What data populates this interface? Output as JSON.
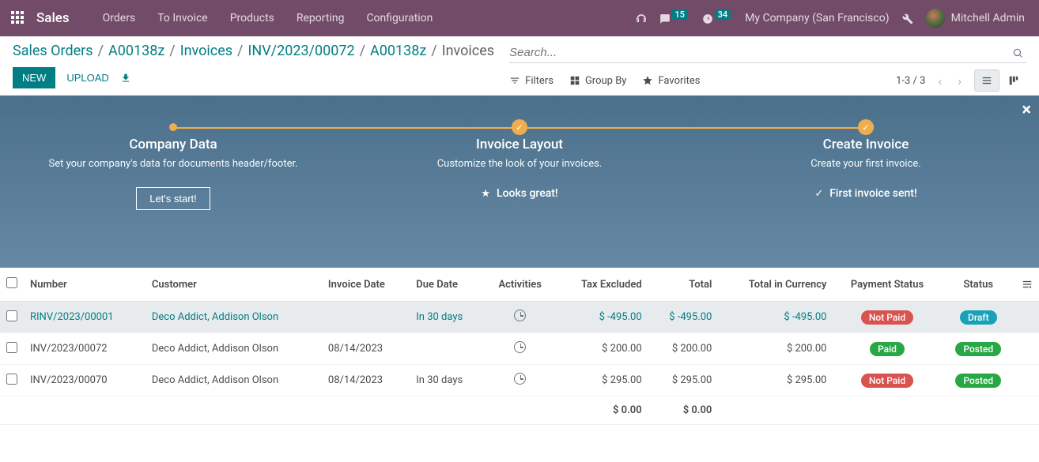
{
  "navbar": {
    "brand": "Sales",
    "links": [
      "Orders",
      "To Invoice",
      "Products",
      "Reporting",
      "Configuration"
    ],
    "messages_count": "15",
    "activities_count": "34",
    "company": "My Company (San Francisco)",
    "user": "Mitchell Admin"
  },
  "breadcrumb": {
    "items": [
      "Sales Orders",
      "A00138z",
      "Invoices",
      "INV/2023/00072",
      "A00138z"
    ],
    "current": "Invoices"
  },
  "actions": {
    "new": "NEW",
    "upload": "UPLOAD"
  },
  "search": {
    "placeholder": "Search..."
  },
  "toolbar": {
    "filters": "Filters",
    "groupby": "Group By",
    "favorites": "Favorites",
    "pager": "1-3 / 3"
  },
  "onboarding": {
    "steps": [
      {
        "title": "Company Data",
        "desc": "Set your company's data for documents header/footer.",
        "action": "Let's start!",
        "done": false,
        "small_dot": true
      },
      {
        "title": "Invoice Layout",
        "desc": "Customize the look of your invoices.",
        "action": "Looks great!",
        "done": true,
        "icon": "star"
      },
      {
        "title": "Create Invoice",
        "desc": "Create your first invoice.",
        "action": "First invoice sent!",
        "done": true,
        "icon": "check"
      }
    ]
  },
  "table": {
    "columns": [
      "Number",
      "Customer",
      "Invoice Date",
      "Due Date",
      "Activities",
      "Tax Excluded",
      "Total",
      "Total in Currency",
      "Payment Status",
      "Status"
    ],
    "rows": [
      {
        "selected": true,
        "number": "RINV/2023/00001",
        "customer": "Deco Addict, Addison Olson",
        "invoice_date": "",
        "due_date": "In 30 days",
        "tax_excluded": "$ -495.00",
        "total": "$ -495.00",
        "total_currency": "$ -495.00",
        "payment_status": "Not Paid",
        "payment_class": "pill-red",
        "status": "Draft",
        "status_class": "pill-blue"
      },
      {
        "selected": false,
        "number": "INV/2023/00072",
        "customer": "Deco Addict, Addison Olson",
        "invoice_date": "08/14/2023",
        "due_date": "",
        "tax_excluded": "$ 200.00",
        "total": "$ 200.00",
        "total_currency": "$ 200.00",
        "payment_status": "Paid",
        "payment_class": "pill-green",
        "status": "Posted",
        "status_class": "pill-green"
      },
      {
        "selected": false,
        "number": "INV/2023/00070",
        "customer": "Deco Addict, Addison Olson",
        "invoice_date": "08/14/2023",
        "due_date": "In 30 days",
        "tax_excluded": "$ 295.00",
        "total": "$ 295.00",
        "total_currency": "$ 295.00",
        "payment_status": "Not Paid",
        "payment_class": "pill-red",
        "status": "Posted",
        "status_class": "pill-green"
      }
    ],
    "footer": {
      "tax_excluded": "$ 0.00",
      "total": "$ 0.00"
    }
  }
}
